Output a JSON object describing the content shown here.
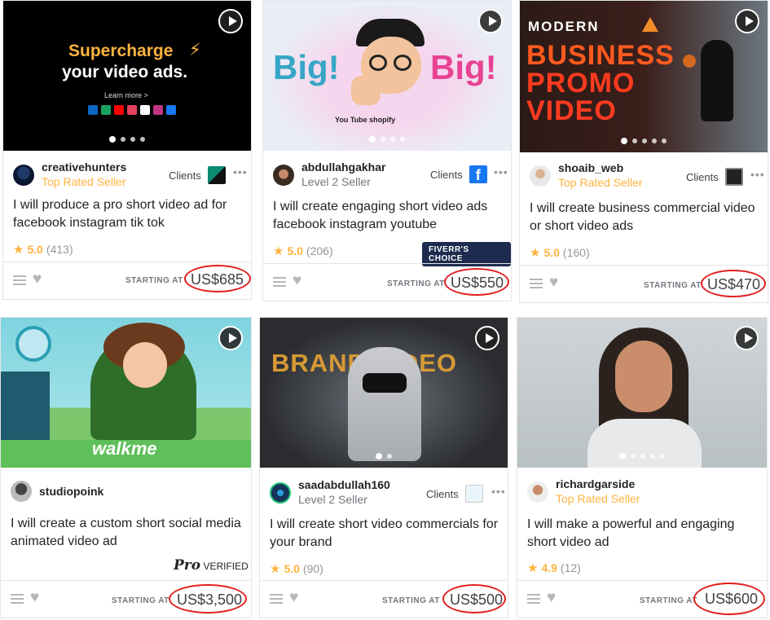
{
  "gigs": [
    {
      "seller": "creativehunters",
      "level": "Top Rated Seller",
      "clients_label": "Clients",
      "title": "I will produce a pro short video ad for facebook instagram tik tok",
      "rating": "5.0",
      "reviews": "(413)",
      "starting_label": "STARTING AT",
      "price": "US$685",
      "thumb": {
        "headline_1": "Supercharge",
        "headline_2": "your video ads.",
        "cta": "Learn more >"
      }
    },
    {
      "seller": "abdullahgakhar",
      "level": "Level 2 Seller",
      "clients_label": "Clients",
      "title": "I will create engaging short video ads facebook instagram youtube",
      "rating": "5.0",
      "reviews": "(206)",
      "badge": "FIVERR'S CHOICE",
      "starting_label": "STARTING AT",
      "price": "US$550",
      "thumb": {
        "word_left": "Big!",
        "word_right": "Big!",
        "logos": "You Tube  shopify"
      }
    },
    {
      "seller": "shoaib_web",
      "level": "Top Rated Seller",
      "clients_label": "Clients",
      "title": "I will create business commercial video or short video ads",
      "rating": "5.0",
      "reviews": "(160)",
      "starting_label": "STARTING AT",
      "price": "US$470",
      "thumb": {
        "kicker": "MODERN",
        "line_1": "BUSINESS",
        "line_2": "PROMO",
        "line_3": "VIDEO"
      }
    },
    {
      "seller": "studiopoink",
      "title": "I will create a custom short social media animated video ad",
      "badge_pro": "Pro",
      "badge_verified": "VERIFIED",
      "starting_label": "STARTING AT",
      "price": "US$3,500",
      "thumb": {
        "brand": "walkme"
      }
    },
    {
      "seller": "saadabdullah160",
      "level": "Level 2 Seller",
      "clients_label": "Clients",
      "title": "I will create short video commercials for your brand",
      "rating": "5.0",
      "reviews": "(90)",
      "starting_label": "STARTING AT",
      "price": "US$500",
      "thumb": {
        "headline": "BRAND VIDEO"
      }
    },
    {
      "seller": "richardgarside",
      "level": "Top Rated Seller",
      "title": "I will make a powerful and engaging short video ad",
      "rating": "4.9",
      "reviews": "(12)",
      "starting_label": "STARTING AT",
      "price": "US$600"
    }
  ],
  "icons": [
    "play-icon",
    "star-icon",
    "menu-icon",
    "heart-icon",
    "more-icon"
  ],
  "colors": {
    "top_rated": "#ffb33e",
    "highlight_ring": "#e01e1e",
    "fiverrs_choice_bg": "#1d2b4e"
  }
}
